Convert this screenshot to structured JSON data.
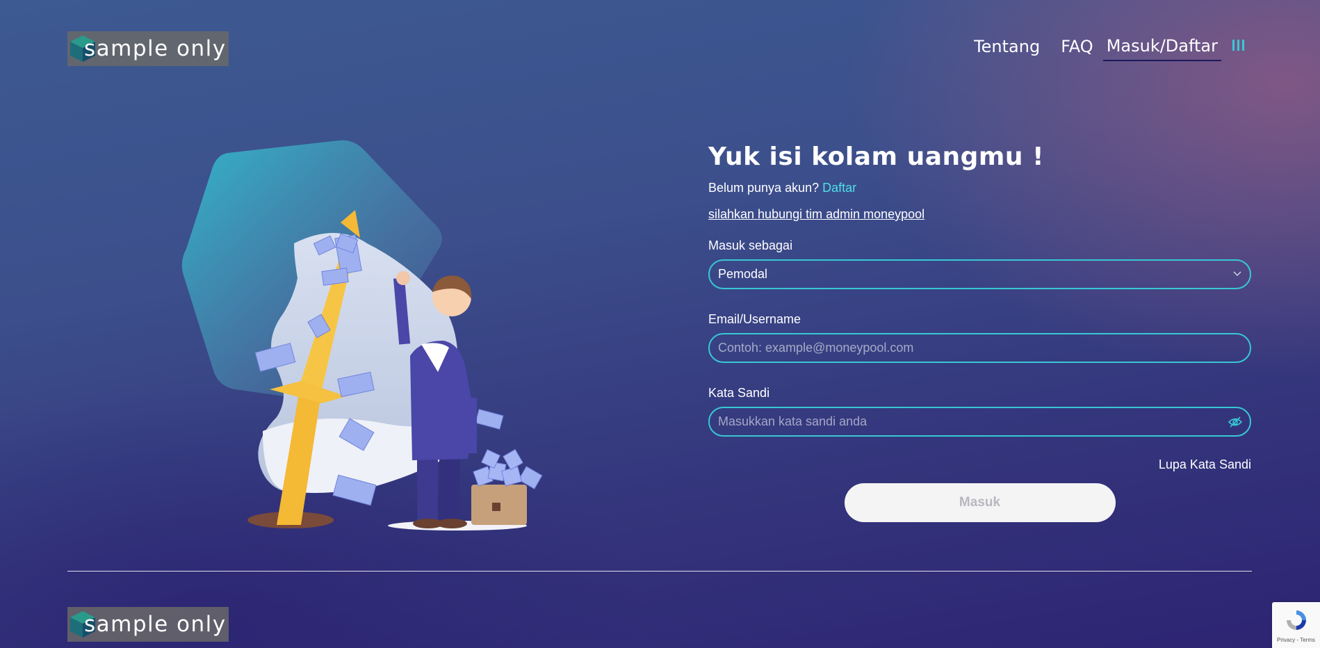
{
  "header": {
    "logo_text": "sample only",
    "nav": [
      {
        "label": "Tentang"
      },
      {
        "label": "FAQ"
      },
      {
        "label": "Masuk/Daftar"
      }
    ]
  },
  "login": {
    "title": "Yuk isi kolam uangmu !",
    "no_account_text": "Belum punya akun?",
    "register_link": "Daftar",
    "admin_link": "silahkan hubungi tim admin moneypool",
    "role_label": "Masuk sebagai",
    "role_value": "Pemodal",
    "email_label": "Email/Username",
    "email_placeholder": "Contoh: example@moneypool.com",
    "password_label": "Kata Sandi",
    "password_placeholder": "Masukkan kata sandi anda",
    "forgot_password": "Lupa Kata Sandi",
    "submit_label": "Masuk"
  },
  "footer": {
    "logo_text": "sample only"
  },
  "recaptcha": {
    "text": "Privacy - Terms"
  },
  "colors": {
    "accent": "#37c8d4",
    "link": "#4ee0e8",
    "button_bg": "#f4f4f4"
  },
  "icons": [
    "cube-logo-icon",
    "menu-bars-icon",
    "chevron-down-icon",
    "eye-slash-icon",
    "recaptcha-icon"
  ]
}
